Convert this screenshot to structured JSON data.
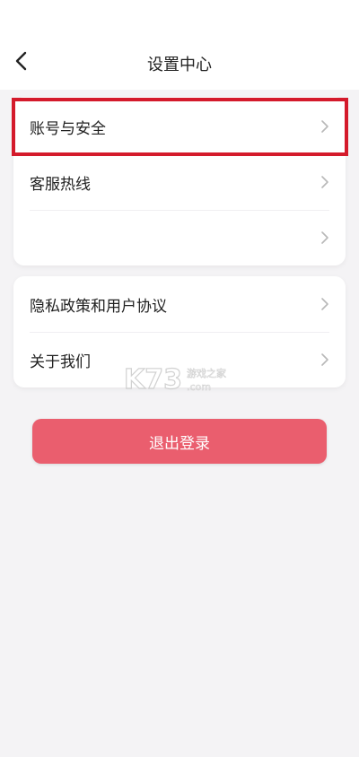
{
  "header": {
    "title": "设置中心"
  },
  "settings_group_1": [
    {
      "label": "账号与安全"
    },
    {
      "label": "客服热线"
    },
    {
      "label": ""
    }
  ],
  "settings_group_2": [
    {
      "label": "隐私政策和用户协议"
    },
    {
      "label": "关于我们"
    }
  ],
  "logout": {
    "label": "退出登录"
  },
  "watermark": {
    "brand": "K73",
    "sub1": "游戏之家",
    "sub2": ".com"
  },
  "colors": {
    "background": "#f4f3f5",
    "card": "#ffffff",
    "logout_button": "#ea5e6e",
    "highlight_box": "#d41a2b"
  },
  "icons": {
    "back": "chevron-left-icon",
    "row_arrow": "chevron-right-icon"
  }
}
